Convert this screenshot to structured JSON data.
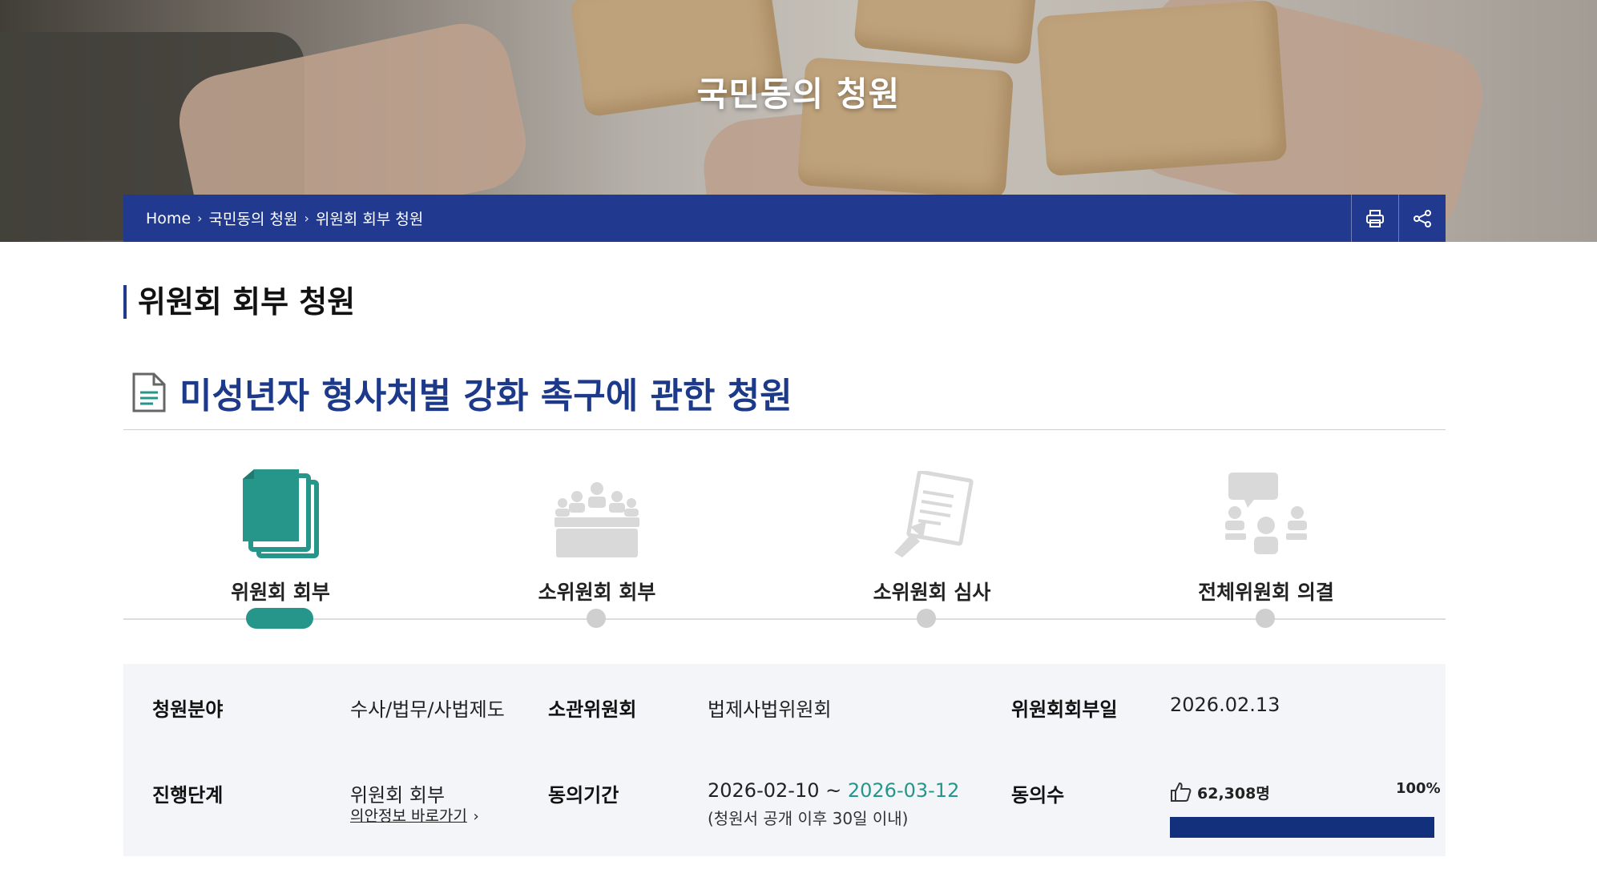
{
  "hero": {
    "title": "국민동의 청원"
  },
  "breadcrumb": {
    "items": [
      "Home",
      "국민동의 청원",
      "위원회 회부 청원"
    ],
    "separator": "›"
  },
  "actions": {
    "print_icon": "print-icon",
    "share_icon": "share-icon"
  },
  "section": {
    "title": "위원회 회부 청원"
  },
  "petition": {
    "title": "미성년자 형사처벌 강화 촉구에 관한 청원",
    "icon": "document-icon"
  },
  "steps": [
    {
      "label": "위원회 회부",
      "icon": "documents-icon",
      "active": true
    },
    {
      "label": "소위원회 회부",
      "icon": "meeting-icon",
      "active": false
    },
    {
      "label": "소위원회 심사",
      "icon": "review-icon",
      "active": false
    },
    {
      "label": "전체위원회 의결",
      "icon": "discussion-icon",
      "active": false
    }
  ],
  "info": {
    "field_label": "청원분야",
    "field_value": "수사/법무/사법제도",
    "committee_label": "소관위원회",
    "committee_value": "법제사법위원회",
    "referral_date_label": "위원회회부일",
    "referral_date_value": "2026.02.13",
    "stage_label": "진행단계",
    "stage_value": "위원회 회부",
    "bill_link": "의안정보 바로가기",
    "period_label": "동의기간",
    "period_start": "2026-02-10 ~",
    "period_end": "2026-03-12",
    "period_note": "(청원서 공개 이후 30일 이내)",
    "votes_label": "동의수",
    "votes_value": "62,308명",
    "votes_percent": "100%",
    "votes_progress": 1.0
  },
  "colors": {
    "navy": "#213a8f",
    "title_blue": "#1d3a8a",
    "teal": "#26958a",
    "progress": "#13307c"
  }
}
